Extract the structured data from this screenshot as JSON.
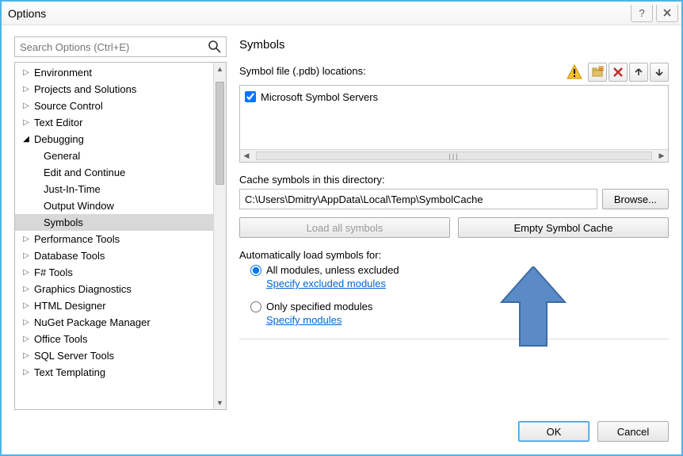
{
  "window": {
    "title": "Options"
  },
  "search": {
    "placeholder": "Search Options (Ctrl+E)"
  },
  "tree": {
    "items": [
      {
        "label": "Environment",
        "expandable": true,
        "open": false,
        "child": false,
        "selected": false
      },
      {
        "label": "Projects and Solutions",
        "expandable": true,
        "open": false,
        "child": false,
        "selected": false
      },
      {
        "label": "Source Control",
        "expandable": true,
        "open": false,
        "child": false,
        "selected": false
      },
      {
        "label": "Text Editor",
        "expandable": true,
        "open": false,
        "child": false,
        "selected": false
      },
      {
        "label": "Debugging",
        "expandable": true,
        "open": true,
        "child": false,
        "selected": false
      },
      {
        "label": "General",
        "expandable": false,
        "open": false,
        "child": true,
        "selected": false
      },
      {
        "label": "Edit and Continue",
        "expandable": false,
        "open": false,
        "child": true,
        "selected": false
      },
      {
        "label": "Just-In-Time",
        "expandable": false,
        "open": false,
        "child": true,
        "selected": false
      },
      {
        "label": "Output Window",
        "expandable": false,
        "open": false,
        "child": true,
        "selected": false
      },
      {
        "label": "Symbols",
        "expandable": false,
        "open": false,
        "child": true,
        "selected": true
      },
      {
        "label": "Performance Tools",
        "expandable": true,
        "open": false,
        "child": false,
        "selected": false
      },
      {
        "label": "Database Tools",
        "expandable": true,
        "open": false,
        "child": false,
        "selected": false
      },
      {
        "label": "F# Tools",
        "expandable": true,
        "open": false,
        "child": false,
        "selected": false
      },
      {
        "label": "Graphics Diagnostics",
        "expandable": true,
        "open": false,
        "child": false,
        "selected": false
      },
      {
        "label": "HTML Designer",
        "expandable": true,
        "open": false,
        "child": false,
        "selected": false
      },
      {
        "label": "NuGet Package Manager",
        "expandable": true,
        "open": false,
        "child": false,
        "selected": false
      },
      {
        "label": "Office Tools",
        "expandable": true,
        "open": false,
        "child": false,
        "selected": false
      },
      {
        "label": "SQL Server Tools",
        "expandable": true,
        "open": false,
        "child": false,
        "selected": false
      },
      {
        "label": "Text Templating",
        "expandable": true,
        "open": false,
        "child": false,
        "selected": false
      }
    ]
  },
  "main": {
    "title": "Symbols",
    "locations_label": "Symbol file (.pdb) locations:",
    "location_items": [
      {
        "checked": true,
        "label": "Microsoft Symbol Servers"
      }
    ],
    "cache_label": "Cache symbols in this directory:",
    "cache_path": "C:\\Users\\Dmitry\\AppData\\Local\\Temp\\SymbolCache",
    "browse_label": "Browse...",
    "load_all_label": "Load all symbols",
    "empty_cache_label": "Empty Symbol Cache",
    "auto_label": "Automatically load symbols for:",
    "radio_all_label": "All modules, unless excluded",
    "link_excluded": "Specify excluded modules",
    "radio_only_label": "Only specified modules",
    "link_specify": "Specify modules"
  },
  "footer": {
    "ok": "OK",
    "cancel": "Cancel"
  }
}
